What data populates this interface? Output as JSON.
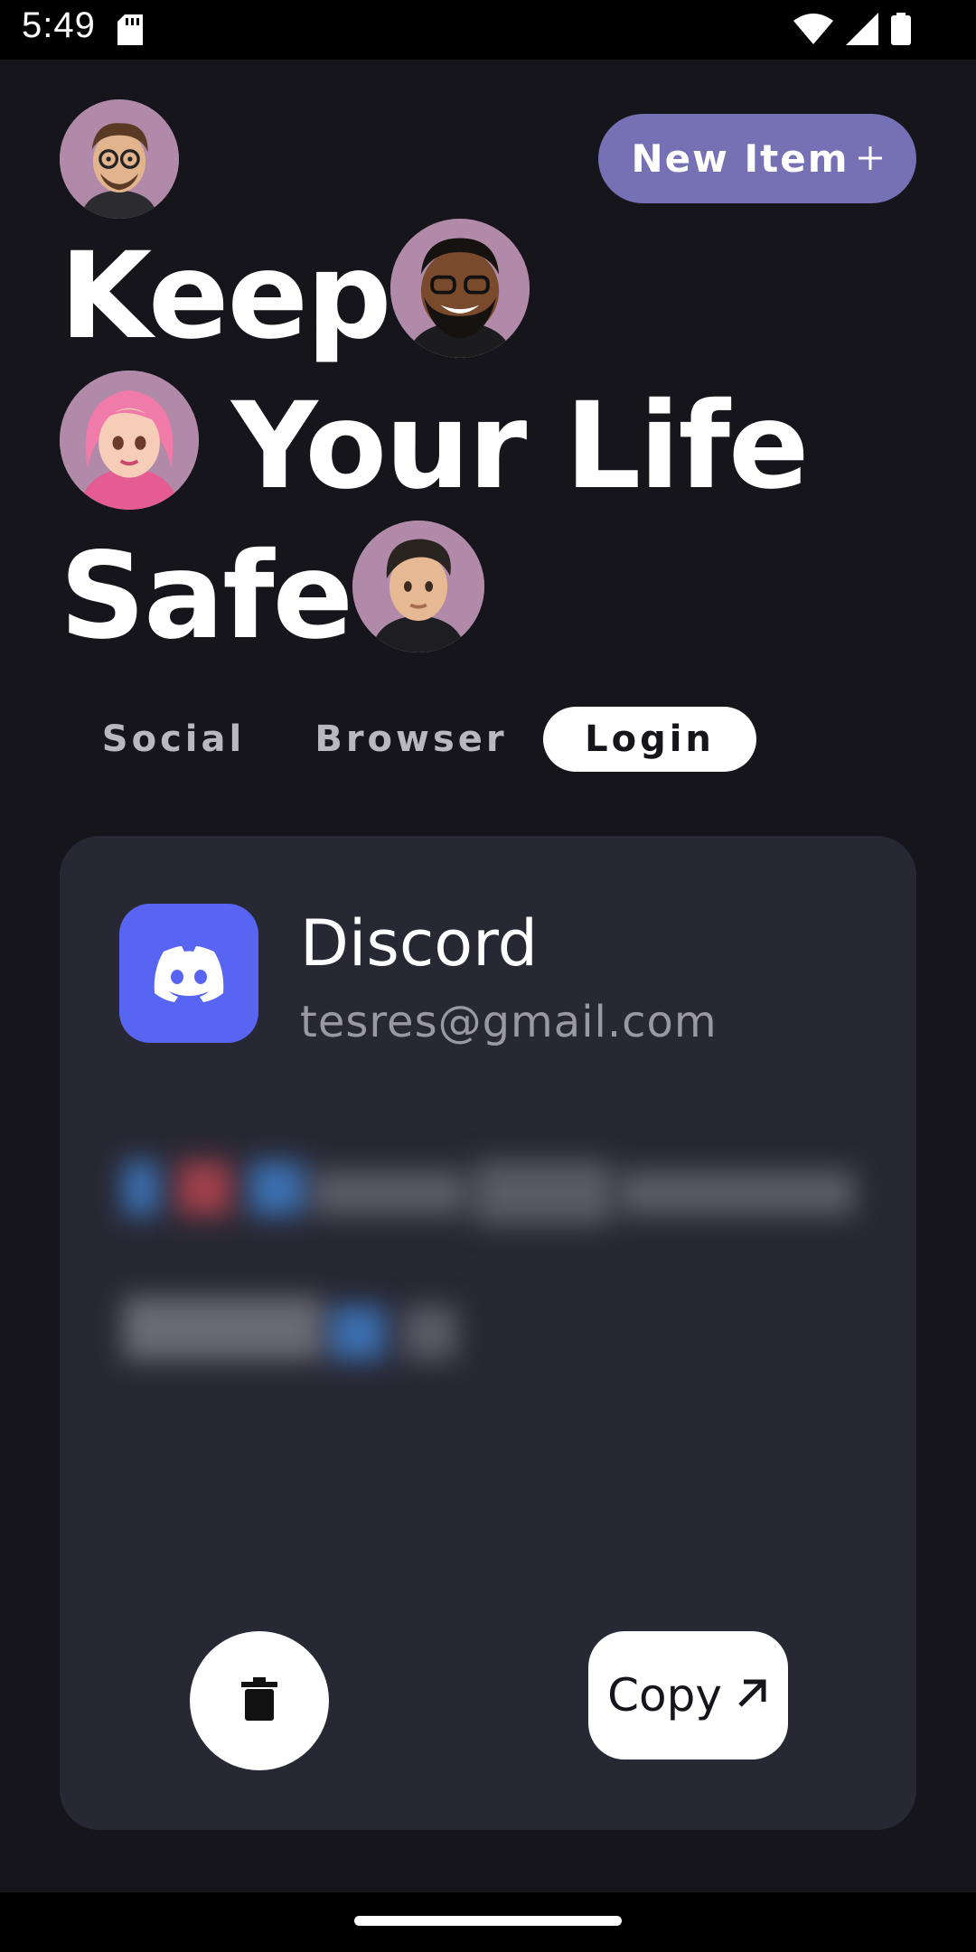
{
  "status_bar": {
    "time": "5:49"
  },
  "header": {
    "new_item_label": "New Item",
    "new_item_icon": "plus-icon"
  },
  "headline": {
    "line1": "Keep",
    "line2": "Your Life",
    "line3": "Safe"
  },
  "tabs": [
    {
      "label": "Social",
      "active": false
    },
    {
      "label": "Browser",
      "active": false
    },
    {
      "label": "Login",
      "active": true
    }
  ],
  "card": {
    "app_name": "Discord",
    "email": "tesres@gmail.com",
    "app_icon": "discord-icon",
    "brand_color": "#5865f2",
    "copy_label": "Copy",
    "copy_icon": "arrow-up-right-icon",
    "delete_icon": "trash-icon"
  },
  "colors": {
    "accent": "#7670b4",
    "background": "#16151b",
    "card": "#282834"
  }
}
